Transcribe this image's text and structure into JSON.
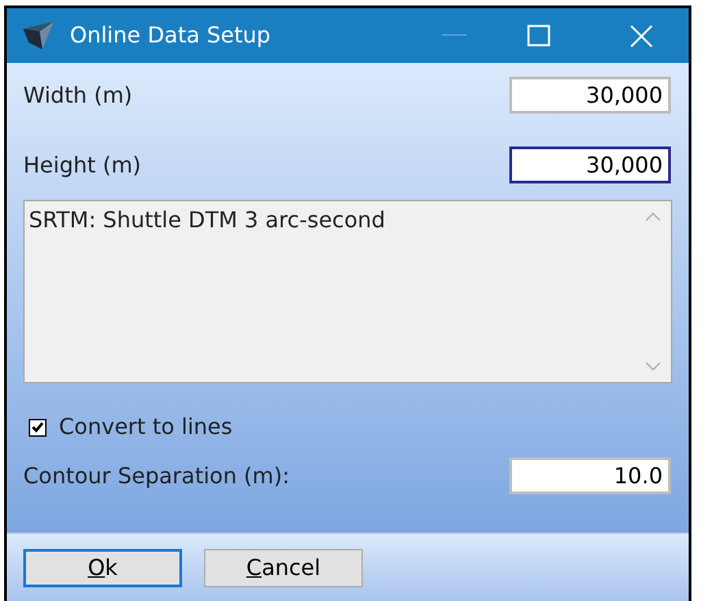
{
  "window": {
    "title": "Online Data Setup"
  },
  "fields": [
    {
      "label": "Width (m)",
      "value": "30,000",
      "focused": false
    },
    {
      "label": "Height (m)",
      "value": "30,000",
      "focused": true
    }
  ],
  "source_list": {
    "items": [
      "SRTM: Shuttle DTM 3 arc-second"
    ]
  },
  "convert_checkbox": {
    "label": "Convert to lines",
    "checked": true
  },
  "contour_field": {
    "label": "Contour Separation (m):",
    "value": "10.0",
    "focused": false
  },
  "buttons": [
    {
      "label": "Ok",
      "default": true
    },
    {
      "label": "Cancel",
      "default": false
    }
  ]
}
